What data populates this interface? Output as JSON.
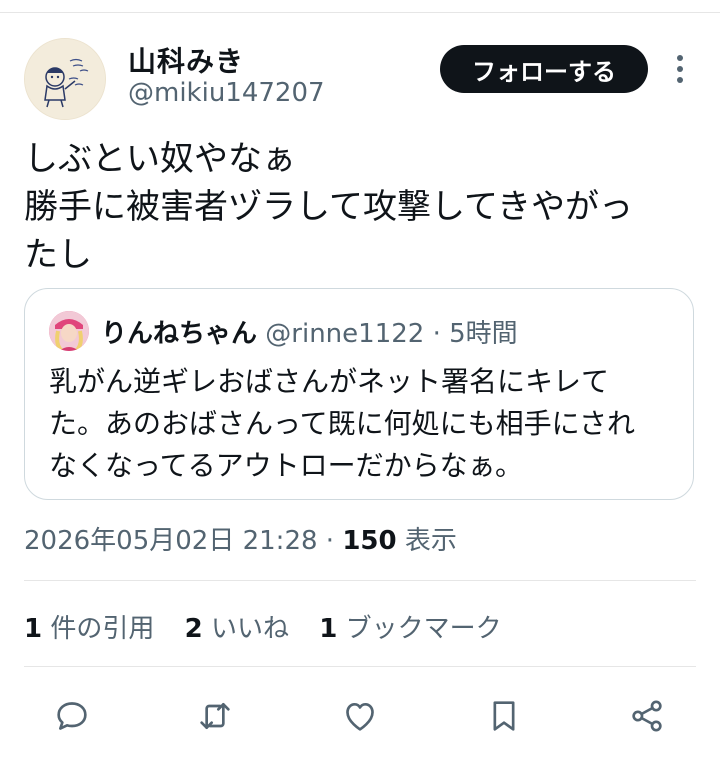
{
  "author": {
    "display_name": "山科みき",
    "handle": "@mikiu147207"
  },
  "follow_button_label": "フォローする",
  "tweet_text": "しぶとい奴やなぁ\n勝手に被害者ヅラして攻撃してきやがっ\nたし",
  "quote": {
    "display_name": "りんねちゃん",
    "handle": "@rinne1122",
    "separator": "·",
    "time": "5時間",
    "text": "乳がん逆ギレおばさんがネット署名にキレて\nた。あのおばさんって既に何処にも相手にされ\nなくなってるアウトローだからなぁ。"
  },
  "meta": {
    "datetime": "2026年05月02日 21:28",
    "separator": "·",
    "views_count": "150",
    "views_label": "表示"
  },
  "stats": [
    {
      "count": "1",
      "label": "件の引用"
    },
    {
      "count": "2",
      "label": "いいね"
    },
    {
      "count": "1",
      "label": "ブックマーク"
    }
  ],
  "colors": {
    "text_primary": "#0f1419",
    "text_secondary": "#536471",
    "button_bg": "#0f1419",
    "border": "#cfd9de",
    "icon": "#536471"
  },
  "action_icons": [
    "reply-icon",
    "retweet-icon",
    "like-icon",
    "bookmark-icon",
    "share-icon"
  ]
}
